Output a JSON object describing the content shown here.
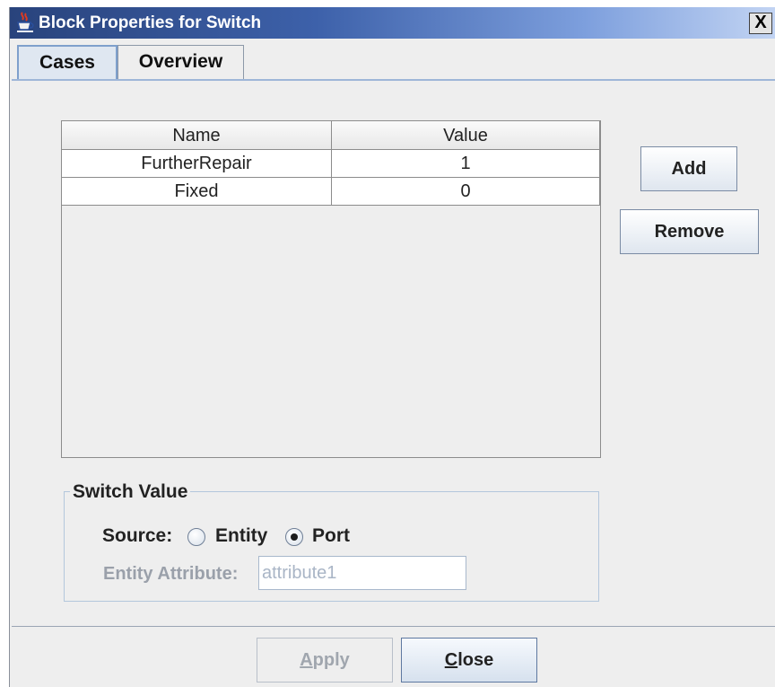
{
  "window": {
    "title": "Block Properties for Switch",
    "close_glyph": "X"
  },
  "tabs": [
    {
      "label": "Cases",
      "active": true
    },
    {
      "label": "Overview",
      "active": false
    }
  ],
  "table": {
    "columns": [
      "Name",
      "Value"
    ],
    "rows": [
      {
        "name": "FurtherRepair",
        "value": "1"
      },
      {
        "name": "Fixed",
        "value": "0"
      }
    ]
  },
  "side_buttons": {
    "add": "Add",
    "remove": "Remove"
  },
  "switch_value": {
    "group_title": "Switch Value",
    "source_label": "Source:",
    "options": [
      {
        "label": "Entity",
        "selected": false
      },
      {
        "label": "Port",
        "selected": true
      }
    ],
    "entity_attribute_label": "Entity Attribute:",
    "entity_attribute_value": "attribute1"
  },
  "footer": {
    "apply": {
      "pre": "",
      "mnemonic": "A",
      "post": "pply",
      "enabled": false
    },
    "close": {
      "pre": "",
      "mnemonic": "C",
      "post": "lose",
      "enabled": true
    }
  },
  "colors": {
    "titlebar_start": "#29437c",
    "titlebar_end": "#c2d4f3",
    "panel_background": "#eeeeee",
    "tab_active_border": "#7fa0cc",
    "disabled_text": "#9aa0aa"
  },
  "icons": {
    "app_icon": "java-coffee-cup-icon",
    "close": "close-icon"
  }
}
